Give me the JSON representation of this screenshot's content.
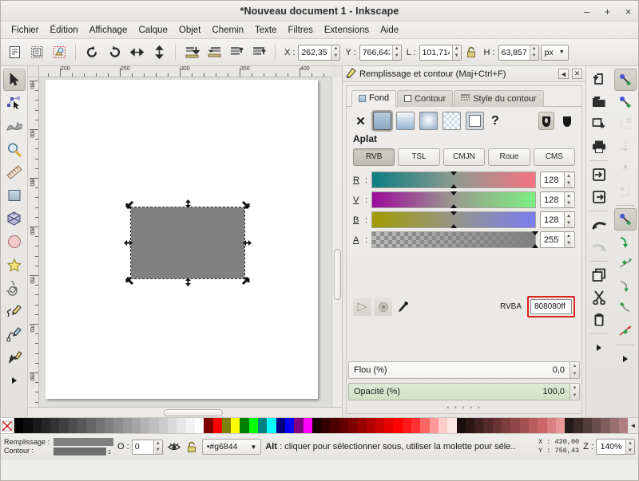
{
  "window": {
    "title": "*Nouveau document 1 - Inkscape",
    "minimize": "–",
    "maximize": "+",
    "close": "×"
  },
  "menubar": {
    "items": [
      {
        "label": "Fichier"
      },
      {
        "label": "Édition"
      },
      {
        "label": "Affichage"
      },
      {
        "label": "Calque"
      },
      {
        "label": "Objet"
      },
      {
        "label": "Chemin"
      },
      {
        "label": "Texte"
      },
      {
        "label": "Filtres"
      },
      {
        "label": "Extensions"
      },
      {
        "label": "Aide"
      }
    ]
  },
  "toolcontrols": {
    "x_label": "X :",
    "x_value": "262,357",
    "y_label": "Y :",
    "y_value": "766,643",
    "w_label": "L :",
    "w_value": "101,714",
    "lock_icon": "lock-icon",
    "h_label": "H :",
    "h_value": "63,857",
    "units": "px",
    "icons": [
      "select-all-icon",
      "select-all-layers-icon",
      "deselect-icon",
      "rotate-ccw-icon",
      "rotate-cw-icon",
      "flip-horizontal-icon",
      "flip-vertical-icon",
      "raise-to-top-icon",
      "raise-icon",
      "lower-icon",
      "lower-to-bottom-icon"
    ]
  },
  "toolbox": {
    "tools": [
      {
        "name": "selector-tool",
        "active": true
      },
      {
        "name": "node-editor-tool",
        "active": false
      },
      {
        "name": "tweak-tool",
        "active": false
      },
      {
        "name": "zoom-tool",
        "active": false
      },
      {
        "name": "measure-tool",
        "active": false
      },
      {
        "name": "rectangle-tool",
        "active": false
      },
      {
        "name": "box3d-tool",
        "active": false
      },
      {
        "name": "ellipse-tool",
        "active": false
      },
      {
        "name": "star-tool",
        "active": false
      },
      {
        "name": "spiral-tool",
        "active": false
      },
      {
        "name": "pencil-tool",
        "active": false
      },
      {
        "name": "bezier-tool",
        "active": false
      },
      {
        "name": "calligraphy-tool",
        "active": false
      },
      {
        "name": "more-tools-arrow",
        "active": false
      }
    ]
  },
  "canvas": {
    "hruler_labels": [
      "200",
      "250",
      "300",
      "350",
      "400"
    ],
    "vruler_labels": [
      "950",
      "900",
      "850",
      "800",
      "750",
      "700",
      "650"
    ],
    "zoom_glass_icon": "zoom-icon",
    "selection": {
      "fill": "#808080",
      "handles": "arrow-handles"
    }
  },
  "panel": {
    "title": "Remplissage et contour (Maj+Ctrl+F)",
    "icon": "fill-stroke-icon",
    "collapse_button": "◄",
    "close_button": "✕",
    "tabs": [
      {
        "label": "Fond",
        "icon": "fill-swatch-icon",
        "active": true
      },
      {
        "label": "Contour",
        "icon": "stroke-swatch-icon",
        "active": false
      },
      {
        "label": "Style du contour",
        "icon": "stroke-style-icon",
        "active": false
      }
    ],
    "fill_types": [
      {
        "name": "no-paint-button",
        "selected": false
      },
      {
        "name": "flat-color-button",
        "selected": true
      },
      {
        "name": "linear-gradient-button",
        "selected": false
      },
      {
        "name": "radial-gradient-button",
        "selected": false
      },
      {
        "name": "pattern-button",
        "selected": false
      },
      {
        "name": "swatch-button",
        "selected": false
      },
      {
        "name": "unknown-paint-button",
        "selected": false
      }
    ],
    "fill_rules": [
      {
        "name": "even-odd-fill-rule-button",
        "selected": true
      },
      {
        "name": "nonzero-fill-rule-button",
        "selected": false
      }
    ],
    "fill_type_label": "Aplat",
    "color_modes": [
      {
        "label": "RVB",
        "selected": true
      },
      {
        "label": "TSL",
        "selected": false
      },
      {
        "label": "CMJN",
        "selected": false
      },
      {
        "label": "Roue",
        "selected": false
      },
      {
        "label": "CMS",
        "selected": false
      }
    ],
    "channels": [
      {
        "label": "R",
        "value": "128",
        "from": "#0c7d82",
        "to": "#f4737f"
      },
      {
        "label": "V",
        "value": "128",
        "from": "#9c0a9c",
        "to": "#7cf081"
      },
      {
        "label": "B",
        "value": "128",
        "from": "#a39b00",
        "to": "#7a7df2"
      },
      {
        "label": "A",
        "value": "255",
        "from": "transparent",
        "to": "#808080"
      }
    ],
    "bottom_tools": [
      {
        "name": "pick-alpha-icon"
      },
      {
        "name": "assign-alpha-icon"
      },
      {
        "name": "color-picker-icon"
      }
    ],
    "rgba_label": "RVBA",
    "rgba_value": "808080ff",
    "rgba_highlight_color": "#e02020",
    "blur": {
      "label": "Flou (%)",
      "value": "0,0"
    },
    "opacity": {
      "label": "Opacité (%)",
      "value": "100,0"
    }
  },
  "command_bar": {
    "left_column": [
      {
        "name": "new-document-icon"
      },
      {
        "name": "open-document-icon"
      },
      {
        "name": "save-document-icon"
      },
      {
        "name": "print-icon"
      },
      {
        "name": "import-icon"
      },
      {
        "name": "export-icon"
      },
      {
        "name": "undo-icon"
      },
      {
        "name": "redo-icon"
      },
      {
        "name": "copy-icon"
      },
      {
        "name": "cut-icon"
      },
      {
        "name": "paste-icon"
      },
      {
        "name": "more-commands-arrow"
      }
    ],
    "right_column": [
      {
        "name": "duplicate-node-icon",
        "active": true
      },
      {
        "name": "snap-bounding-box-icon",
        "active": false
      },
      {
        "name": "snap-bbox-corners-icon",
        "active": false
      },
      {
        "name": "snap-bbox-edges-icon",
        "active": false
      },
      {
        "name": "snap-bbox-midpoints-icon",
        "active": false
      },
      {
        "name": "snap-bbox-centers-icon",
        "active": false
      },
      {
        "name": "snap-nodes-icon",
        "active": true
      },
      {
        "name": "snap-paths-icon",
        "active": false
      },
      {
        "name": "snap-path-intersections-icon",
        "active": false
      },
      {
        "name": "snap-cusp-nodes-icon",
        "active": false
      },
      {
        "name": "snap-smooth-nodes-icon",
        "active": false
      },
      {
        "name": "snap-midpoints-icon",
        "active": false
      },
      {
        "name": "more-snap-arrow",
        "active": false
      }
    ]
  },
  "palette": {
    "none_icon": "no-color-icon",
    "scroll_arrow": "◄",
    "colors": [
      "#000000",
      "#0d0d0d",
      "#1a1a1a",
      "#262626",
      "#333333",
      "#404040",
      "#4d4d4d",
      "#595959",
      "#666666",
      "#737373",
      "#808080",
      "#8c8c8c",
      "#999999",
      "#a6a6a6",
      "#b3b3b3",
      "#bfbfbf",
      "#cccccc",
      "#d9d9d9",
      "#e6e6e6",
      "#f2f2f2",
      "#ffffff",
      "#800000",
      "#ff0000",
      "#808000",
      "#ffff00",
      "#008000",
      "#00ff00",
      "#008080",
      "#00ffff",
      "#000080",
      "#0000ff",
      "#800080",
      "#ff00ff",
      "#1a0000",
      "#330000",
      "#4d0000",
      "#660000",
      "#800000",
      "#990000",
      "#b30000",
      "#cc0000",
      "#e60000",
      "#ff0000",
      "#ff1a1a",
      "#ff3333",
      "#ff6666",
      "#ff9999",
      "#ffcccc",
      "#ffe6e6",
      "#1a0d0d",
      "#2e1717",
      "#412020",
      "#552a2a",
      "#693333",
      "#7d3d3d",
      "#914747",
      "#a55151",
      "#b85b5b",
      "#cc6666",
      "#d98080",
      "#e69999",
      "#241a1a",
      "#3b2b2b",
      "#523c3c",
      "#6a4d4d",
      "#815e5e",
      "#996f6f",
      "#b08080"
    ]
  },
  "statusbar": {
    "fill_label": "Remplissage :",
    "stroke_label": "Contour :",
    "fill_color": "#808080",
    "stroke_color": "#6d6d6d",
    "stroke_width": "1",
    "opacity_label": "O :",
    "opacity_value": "0",
    "eye_icon": "visibility-icon",
    "lock_icon": "layer-lock-icon",
    "layer_name": "#g6844",
    "layer_bullet": "•",
    "dropdown_arrow": "▼",
    "message_prefix": "Alt",
    "message": " : cliquer pour sélectionner sous, utiliser la molette pour séle..",
    "x_label": "X :",
    "x_value": "420,00",
    "y_label": "Y :",
    "y_value": "756,43",
    "zoom_label": "Z :",
    "zoom_value": "140%"
  }
}
